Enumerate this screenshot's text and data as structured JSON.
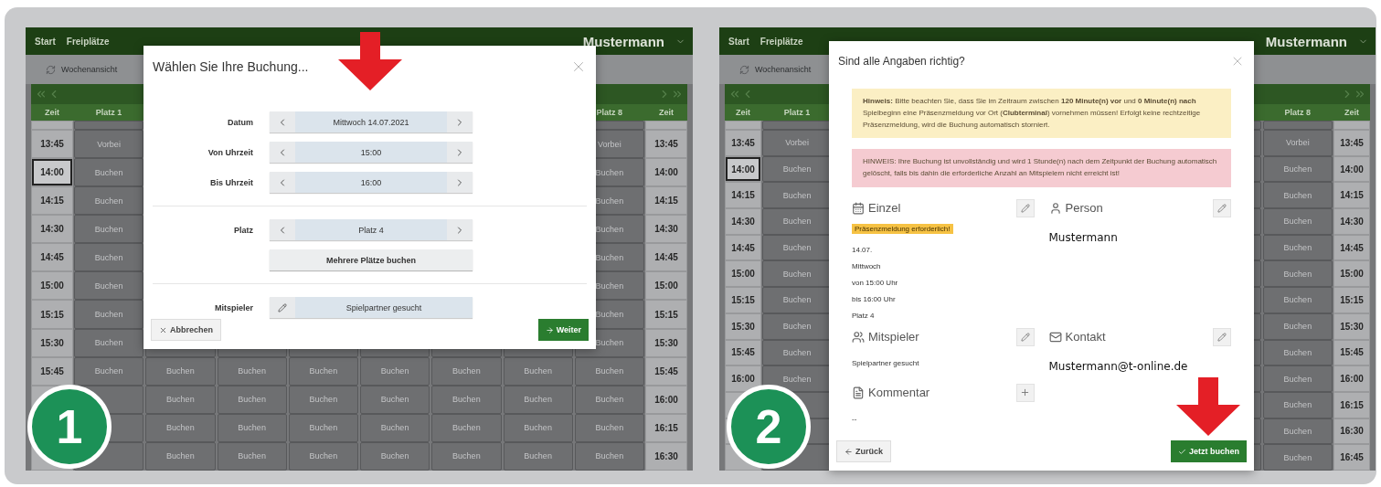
{
  "panels": [
    {
      "badge": "1",
      "nav": {
        "links": [
          "Start",
          "Freiplätze"
        ],
        "user": "Mustermann"
      },
      "toolbar": {
        "view": "Wochenansicht"
      },
      "header": {
        "left_time": "Zeit",
        "first": "Platz 1",
        "last": "Platz 8",
        "right_time": "Zeit"
      },
      "rows": [
        {
          "left": "13:45",
          "right": "13:45",
          "first": "Vorbei",
          "last": "Vorbei",
          "current": false
        },
        {
          "left": "14:00",
          "right": "14:00",
          "first": "Buchen",
          "last": "Buchen",
          "current": true
        },
        {
          "left": "14:15",
          "right": "14:15",
          "first": "Buchen",
          "last": "Buchen",
          "current": false
        },
        {
          "left": "14:30",
          "right": "14:30",
          "first": "Buchen",
          "last": "Buchen",
          "current": false
        },
        {
          "left": "14:45",
          "right": "14:45",
          "first": "Buchen",
          "last": "Buchen",
          "current": false
        },
        {
          "left": "15:00",
          "right": "15:00",
          "first": "Buchen",
          "last": "Buchen",
          "current": false
        },
        {
          "left": "15:15",
          "right": "15:15",
          "first": "Buchen",
          "last": "Buchen",
          "current": false
        },
        {
          "left": "15:30",
          "right": "15:30",
          "first": "Buchen",
          "last": "Buchen",
          "current": false
        },
        {
          "left": "15:45",
          "right": "15:45",
          "first": "Buchen",
          "middle": [
            "Buchen",
            "Buchen",
            "Buchen",
            "Buchen",
            "Buchen",
            "Buchen"
          ],
          "last": "Buchen",
          "current": false
        },
        {
          "right": "16:00",
          "middle": [
            "Buchen",
            "Buchen",
            "Buchen",
            "Buchen",
            "Buchen",
            "Buchen"
          ],
          "last": "Buchen",
          "current": false
        },
        {
          "right": "16:15",
          "middle": [
            "Buchen",
            "Buchen",
            "Buchen",
            "Buchen",
            "Buchen",
            "Buchen"
          ],
          "last": "Buchen",
          "current": false
        },
        {
          "right": "16:30",
          "middle": [
            "Buchen",
            "Buchen",
            "Buchen",
            "Buchen",
            "Buchen",
            "Buchen"
          ],
          "last": "Buchen",
          "current": false
        }
      ],
      "booking_dialog": {
        "title": "Wählen Sie Ihre Buchung...",
        "time_fields": [
          {
            "label": "Datum",
            "value": "Mittwoch 14.07.2021"
          },
          {
            "label": "Von Uhrzeit",
            "value": "15:00"
          },
          {
            "label": "Bis Uhrzeit",
            "value": "16:00"
          }
        ],
        "court_field": {
          "label": "Platz",
          "value": "Platz 4"
        },
        "multi_button": "Mehrere Plätze buchen",
        "partner_field": {
          "label": "Mitspieler",
          "value": "Spielpartner gesucht"
        },
        "cancel": "Abbrechen",
        "next": "Weiter"
      }
    },
    {
      "badge": "2",
      "nav": {
        "links": [
          "Start",
          "Freiplätze"
        ],
        "user": "Mustermann"
      },
      "toolbar": {
        "view": "Wochenansicht"
      },
      "header": {
        "left_time": "Zeit",
        "first": "Platz 1",
        "last": "Platz 8",
        "right_time": "Zeit"
      },
      "rows": [
        {
          "left": "13:45",
          "right": "13:45",
          "first": "Vorbei",
          "last": "Vorbei",
          "current": false
        },
        {
          "left": "14:00",
          "right": "14:00",
          "first": "Buchen",
          "last": "Buchen",
          "current": true
        },
        {
          "left": "14:15",
          "right": "14:15",
          "first": "Buchen",
          "last": "Buchen",
          "current": false
        },
        {
          "left": "14:30",
          "right": "14:30",
          "first": "Buchen",
          "last": "Buchen",
          "current": false
        },
        {
          "left": "14:45",
          "right": "14:45",
          "first": "Buchen",
          "last": "Buchen",
          "current": false
        },
        {
          "left": "15:00",
          "right": "15:00",
          "first": "Buchen",
          "last": "Buchen",
          "current": false
        },
        {
          "left": "15:15",
          "right": "15:15",
          "first": "Buchen",
          "last": "Buchen",
          "current": false
        },
        {
          "left": "15:30",
          "right": "15:30",
          "first": "Buchen",
          "last": "Buchen",
          "current": false
        },
        {
          "left": "15:45",
          "right": "15:45",
          "first": "Buchen",
          "last": "Buchen",
          "current": false
        },
        {
          "left": "16:00",
          "right": "16:00",
          "first": "Buchen",
          "last": "Buchen",
          "current": false
        },
        {
          "right": "16:15",
          "last": "Buchen",
          "current": false
        },
        {
          "right": "16:30",
          "last": "Buchen",
          "current": false
        },
        {
          "right": "16:45",
          "last": "Buchen",
          "current": false
        }
      ],
      "confirm_dialog": {
        "title": "Sind alle Angaben richtig?",
        "notice": "**Hinweis:** Bitte beachten Sie, dass Sie im Zeitraum zwischen **120 Minute(n) vor** und **0 Minute(n) nach** Spielbeginn eine Präsenzmeldung vor Ort (**Clubterminal**) vornehmen müssen! Erfolgt keine rechtzeitige Präsenzmeldung, wird die Buchung automatisch storniert.",
        "warning": "HINWEIS: Ihre Buchung ist unvollständig und wird 1 Stunde(n) nach dem Zeitpunkt der Buchung automatisch gelöscht, falls bis dahin die erforderliche Anzahl an Mitspielern nicht erreicht ist!",
        "sections": [
          {
            "kind": "calendar",
            "title": "Einzel",
            "addable": false,
            "tag": "Präsenzmeldung erforderlich!",
            "lines": [
              "14.07.",
              "Mittwoch",
              "von 15:00 Uhr",
              "bis 16:00 Uhr",
              "Platz 4"
            ]
          },
          {
            "kind": "person",
            "title": "Person",
            "addable": false,
            "value": "Mustermann"
          },
          {
            "kind": "players",
            "title": "Mitspieler",
            "addable": false,
            "lines": [
              "Spielpartner gesucht"
            ]
          },
          {
            "kind": "contact",
            "title": "Kontakt",
            "addable": false,
            "value": "Mustermann@t-online.de"
          },
          {
            "kind": "comment",
            "title": "Kommentar",
            "addable": true,
            "lines": [
              "--"
            ]
          }
        ],
        "back": "Zurück",
        "submit": "Jetzt buchen"
      }
    }
  ]
}
